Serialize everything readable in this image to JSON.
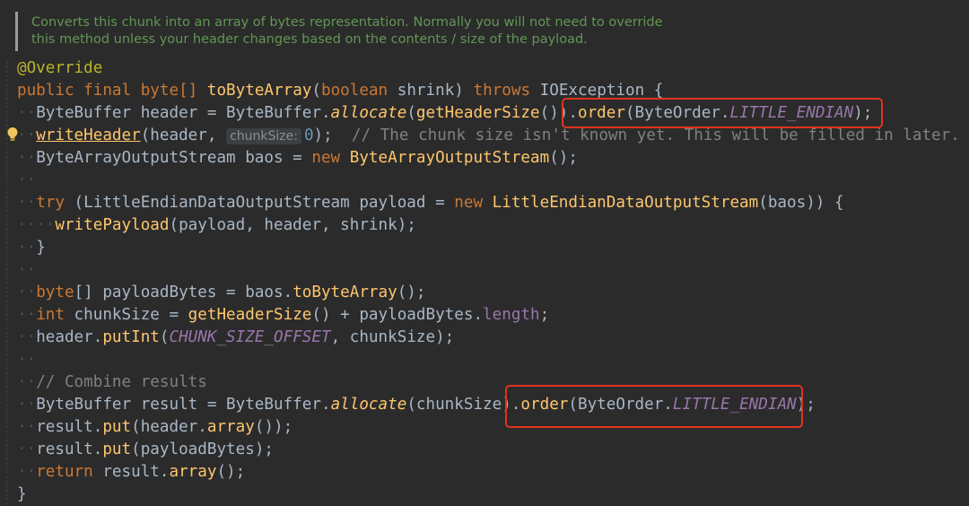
{
  "doc_comment": {
    "line1": "Converts this chunk into an array of bytes representation. Normally you will not need to override",
    "line2": "this method unless your header changes based on the contents / size of the payload."
  },
  "code": {
    "annotation": "@Override",
    "sig": {
      "mods": "public final byte[]",
      "method": "toByteArray",
      "open": "(",
      "ptype": "boolean",
      "pname": " shrink) ",
      "throws": "throws",
      "exc": " IOException {"
    },
    "l3": {
      "a": "ByteBuffer header = ByteBuffer.",
      "b": "allocate",
      "c": "(",
      "d": "getHeaderSize",
      "e": "()).",
      "f": "order",
      "g": "(ByteOrder.",
      "h": "LITTLE_ENDIAN",
      "i": ");"
    },
    "l4": {
      "a": "writeHeader",
      "b": "(header, ",
      "hint": "chunkSize:",
      "num": "0",
      "c": ");  ",
      "cmt": "// The chunk size isn't known yet. This will be filled in later."
    },
    "l5": {
      "a": "ByteArrayOutputStream baos = ",
      "kw": "new",
      "b": " ByteArrayOutputStream",
      "c": "();"
    },
    "l7": {
      "kw": "try",
      "a": " (LittleEndianDataOutputStream payload = ",
      "kw2": "new",
      "b": " LittleEndianDataOutputStream",
      "c": "(baos)) {"
    },
    "l8": {
      "a": "writePayload",
      "b": "(payload, header, shrink);"
    },
    "l9": "}",
    "l11": {
      "kw": "byte",
      "a": "[] payloadBytes = baos.",
      "b": "toByteArray",
      "c": "();"
    },
    "l12": {
      "kw": "int",
      "a": " chunkSize = ",
      "b": "getHeaderSize",
      "c": "() + payloadBytes.",
      "d": "length",
      "e": ";"
    },
    "l13": {
      "a": "header.",
      "b": "putInt",
      "c": "(",
      "d": "CHUNK_SIZE_OFFSET",
      "e": ", chunkSize);"
    },
    "l15": "// Combine results",
    "l16": {
      "a": "ByteBuffer result = ByteBuffer.",
      "b": "allocate",
      "c": "(chunkSize).",
      "d": "order",
      "e": "(ByteOrder.",
      "f": "LITTLE_ENDIAN",
      "g": ");"
    },
    "l17": {
      "a": "result.",
      "b": "put",
      "c": "(header.",
      "d": "array",
      "e": "());"
    },
    "l18": {
      "a": "result.",
      "b": "put",
      "c": "(payloadBytes);"
    },
    "l19": {
      "kw": "return",
      "a": " result.",
      "b": "array",
      "c": "();"
    },
    "l20": "}"
  },
  "colors": {
    "background": "#2b2b2b",
    "highlight_box": "#e0331f",
    "keyword": "#cc7832",
    "method": "#ffc66d",
    "constant": "#9876aa",
    "doc_comment": "#629755"
  },
  "icons": {
    "intention_bulb": "lightbulb-icon"
  }
}
